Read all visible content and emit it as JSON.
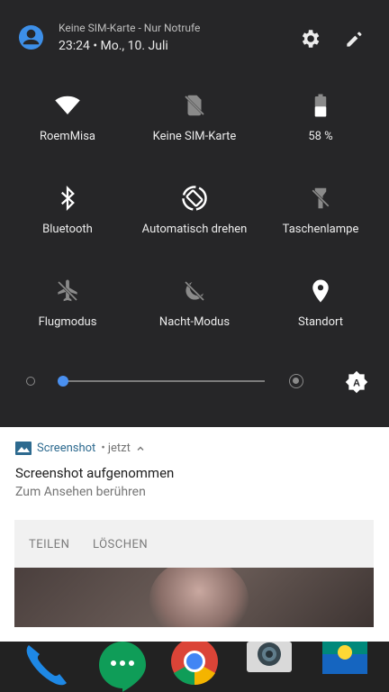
{
  "status": {
    "carrier": "Keine SIM-Karte - Nur Notrufe",
    "datetime": "23:24 • Mo., 10. Juli"
  },
  "tiles": [
    {
      "label": "RoemMisa",
      "icon": "wifi-icon"
    },
    {
      "label": "Keine SIM-Karte",
      "icon": "no-sim-icon"
    },
    {
      "label": "58 %",
      "icon": "battery-icon"
    },
    {
      "label": "Bluetooth",
      "icon": "bluetooth-icon"
    },
    {
      "label": "Automatisch drehen",
      "icon": "auto-rotate-icon"
    },
    {
      "label": "Taschenlampe",
      "icon": "flashlight-off-icon"
    },
    {
      "label": "Flugmodus",
      "icon": "airplane-off-icon"
    },
    {
      "label": "Nacht-Modus",
      "icon": "night-mode-off-icon"
    },
    {
      "label": "Standort",
      "icon": "location-icon"
    }
  ],
  "battery_percent": 58,
  "brightness": {
    "level": 0.0,
    "accent": "#4a90f0"
  },
  "notification": {
    "app": "Screenshot",
    "meta": "• jetzt",
    "title": "Screenshot aufgenommen",
    "text": "Zum Ansehen berühren",
    "actions": [
      "TEILEN",
      "LÖSCHEN"
    ]
  },
  "dock": [
    "phone-icon",
    "hangouts-icon",
    "chrome-icon",
    "camera-icon",
    "gallery-icon"
  ],
  "colors": {
    "panel": "#262628",
    "accent": "#4a90f0",
    "app_name": "#2d6a8f"
  }
}
